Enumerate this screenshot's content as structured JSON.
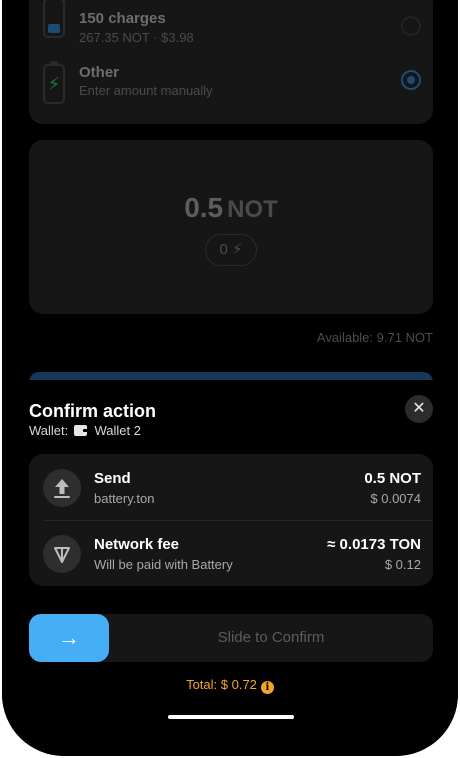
{
  "options": [
    {
      "title": "150 charges",
      "subtitle": "267.35 NOT · $3.98",
      "selected": false
    },
    {
      "title": "Other",
      "subtitle": "Enter amount manually",
      "selected": true
    }
  ],
  "amount": {
    "value": "0.5",
    "currency": "NOT",
    "charges": "0"
  },
  "available": "Available: 9.71 NOT",
  "sheet": {
    "title": "Confirm action",
    "wallet_label": "Wallet:",
    "wallet_name": "Wallet 2",
    "close_icon": "close-icon"
  },
  "details": [
    {
      "icon": "arrow-up-icon",
      "title": "Send",
      "subtitle": "battery.ton",
      "value": "0.5 NOT",
      "fiat": "$ 0.0074"
    },
    {
      "icon": "ton-diamond-icon",
      "title": "Network fee",
      "subtitle": "Will be paid with Battery",
      "value": "≈ 0.0173 TON",
      "fiat": "$ 0.12"
    }
  ],
  "slider": {
    "label": "Slide to Confirm",
    "icon": "arrow-right-icon"
  },
  "total": "Total: $ 0.72",
  "colors": {
    "accent": "#45aef5",
    "total": "#f5a524",
    "card": "#161616"
  }
}
